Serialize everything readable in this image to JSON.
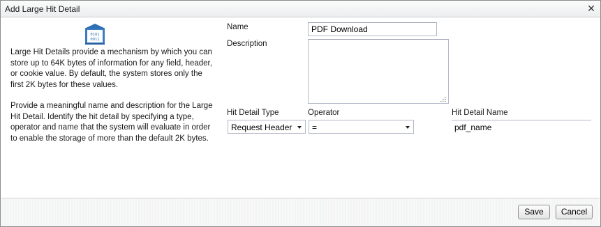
{
  "dialog": {
    "title": "Add Large Hit Detail",
    "close_icon": "close-icon"
  },
  "info": {
    "icon": "binary-archive-icon",
    "paragraph1": "Large Hit Details provide a mechanism by which you can store up to 64K bytes of information for any field, header, or cookie value. By default, the system stores only the first 2K bytes for these values.",
    "paragraph2": "Provide a meaningful name and description for the Large Hit Detail. Identify the hit detail by specifying a type, operator and name that the system will evaluate in order to enable the storage of more than the default 2K bytes."
  },
  "form": {
    "name_label": "Name",
    "name_value": "PDF Download",
    "description_label": "Description",
    "description_value": "",
    "hit_detail_type_label": "Hit Detail Type",
    "hit_detail_type_value": "Request Header",
    "operator_label": "Operator",
    "operator_value": "=",
    "hit_detail_name_label": "Hit Detail Name",
    "hit_detail_name_value": "pdf_name"
  },
  "footer": {
    "save_label": "Save",
    "cancel_label": "Cancel"
  }
}
